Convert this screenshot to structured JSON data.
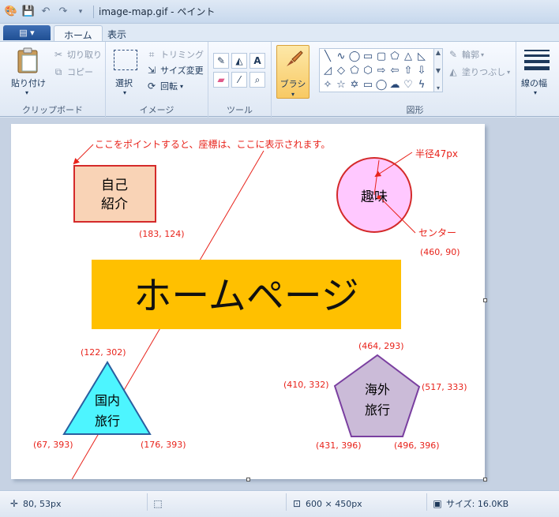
{
  "window": {
    "title": "image-map.gif - ペイント",
    "quick_access_icons": [
      "app-icon",
      "save-icon",
      "undo-icon",
      "redo-icon",
      "customize-icon"
    ]
  },
  "tabs": [
    {
      "label": "ホーム",
      "active": true
    },
    {
      "label": "表示",
      "active": false
    }
  ],
  "ribbon": {
    "clipboard": {
      "label": "クリップボード",
      "paste": "貼り付け",
      "cut": "切り取り",
      "copy": "コピー"
    },
    "image": {
      "label": "イメージ",
      "select": "選択",
      "crop": "トリミング",
      "resize": "サイズ変更",
      "rotate": "回転"
    },
    "tools": {
      "label": "ツール"
    },
    "brush": {
      "label": "ブラシ"
    },
    "shapes": {
      "label": "図形",
      "outline": "輪郭",
      "fill": "塗りつぶし"
    },
    "line_width": {
      "label": "線の幅"
    }
  },
  "image": {
    "note": "ここをポイントすると、座標は、ここに表示されます。",
    "self_intro": [
      "自己",
      "紹介"
    ],
    "self_intro_coord": "(183, 124)",
    "hobby": "趣味",
    "radius": "半径47px",
    "center": "センター",
    "hobby_coord": "(460, 90)",
    "homepage": "ホームページ",
    "domestic": [
      "国内",
      "旅行"
    ],
    "tri_top": "(122, 302)",
    "tri_left": "(67, 393)",
    "tri_right": "(176, 393)",
    "overseas": [
      "海外",
      "旅行"
    ],
    "pent_top": "(464, 293)",
    "pent_left": "(410, 332)",
    "pent_right": "(517, 333)",
    "pent_bl": "(431, 396)",
    "pent_br": "(496, 396)",
    "colors": {
      "annotation": "#e8231b",
      "self_intro_fill": "#f9d3b6",
      "hobby_fill": "#ffc8ff",
      "banner": "#ffc000",
      "triangle": "#4df5ff",
      "pentagon": "#cbbbd8"
    }
  },
  "status": {
    "cursor": "80, 53px",
    "canvas_size": "600 × 450px",
    "file_size": "サイズ: 16.0KB"
  }
}
